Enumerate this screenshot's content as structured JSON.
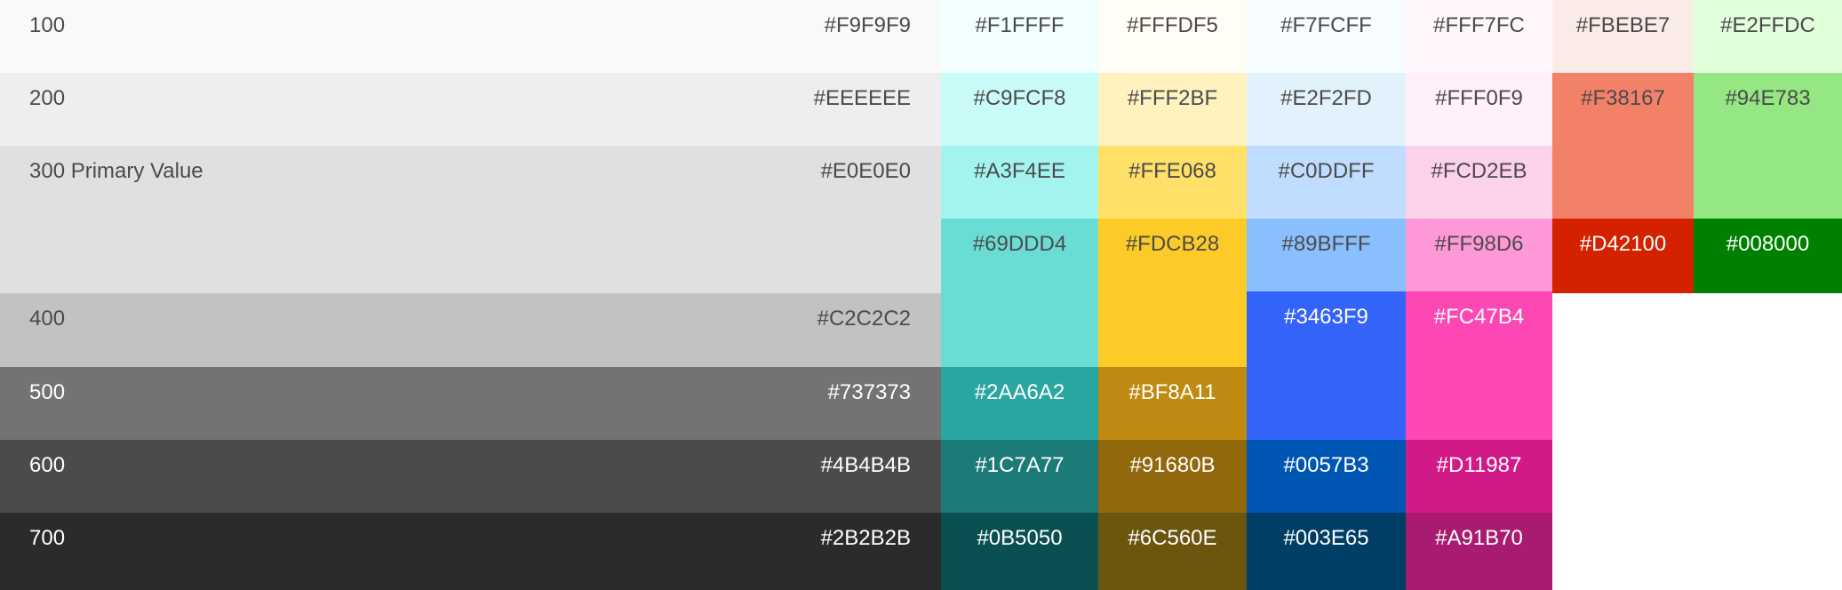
{
  "gray": [
    {
      "label": "100",
      "hex": "#F9F9F9",
      "color": "#F9F9F9",
      "text_color": "#4B4B4B"
    },
    {
      "label": "200",
      "hex": "#EEEEEE",
      "color": "#EEEEEE",
      "text_color": "#4B4B4B"
    },
    {
      "label": "300 Primary Value",
      "hex": "#E0E0E0",
      "color": "#E0E0E0",
      "text_color": "#4B4B4B"
    },
    {
      "label": "400",
      "hex": "#C2C2C2",
      "color": "#C2C2C2",
      "text_color": "#4B4B4B"
    },
    {
      "label": "500",
      "hex": "#737373",
      "color": "#737373",
      "text_color": "#FFFFFF"
    },
    {
      "label": "600",
      "hex": "#4B4B4B",
      "color": "#4B4B4B",
      "text_color": "#FFFFFF"
    },
    {
      "label": "700",
      "hex": "#2B2B2B",
      "color": "#2B2B2B",
      "text_color": "#FFFFFF"
    }
  ],
  "teal": [
    {
      "hex": "#F1FFFF",
      "color": "#F1FFFF",
      "text_color": "#4B4B4B"
    },
    {
      "hex": "#C9FCF8",
      "color": "#C9FCF8",
      "text_color": "#4B4B4B"
    },
    {
      "hex": "#A3F4EE",
      "color": "#A3F4EE",
      "text_color": "#4B4B4B"
    },
    {
      "hex": "#69DDD4",
      "color": "#69DDD4",
      "text_color": "#4B4B4B"
    },
    {
      "hex": "#2AA6A2",
      "color": "#2AA6A2",
      "text_color": "#FFFFFF"
    },
    {
      "hex": "#1C7A77",
      "color": "#1C7A77",
      "text_color": "#FFFFFF"
    },
    {
      "hex": "#0B5050",
      "color": "#0B5050",
      "text_color": "#FFFFFF"
    }
  ],
  "yellow": [
    {
      "hex": "#FFFDF5",
      "color": "#FFFDF5",
      "text_color": "#4B4B4B"
    },
    {
      "hex": "#FFF2BF",
      "color": "#FFF2BF",
      "text_color": "#4B4B4B"
    },
    {
      "hex": "#FFE068",
      "color": "#FFE068",
      "text_color": "#4B4B4B"
    },
    {
      "hex": "#FDCB28",
      "color": "#FDCB28",
      "text_color": "#4B4B4B"
    },
    {
      "hex": "#BF8A11",
      "color": "#BF8A11",
      "text_color": "#FFFFFF"
    },
    {
      "hex": "#91680B",
      "color": "#91680B",
      "text_color": "#FFFFFF"
    },
    {
      "hex": "#6C560E",
      "color": "#6C560E",
      "text_color": "#FFFFFF"
    }
  ],
  "blue": [
    {
      "hex": "#F7FCFF",
      "color": "#F7FCFF",
      "text_color": "#4B4B4B"
    },
    {
      "hex": "#E2F2FD",
      "color": "#E2F2FD",
      "text_color": "#4B4B4B"
    },
    {
      "hex": "#C0DDFF",
      "color": "#C0DDFF",
      "text_color": "#4B4B4B"
    },
    {
      "hex": "#89BFFF",
      "color": "#89BFFF",
      "text_color": "#4B4B4B"
    },
    {
      "hex": "#3463F9",
      "color": "#3463F9",
      "text_color": "#FFFFFF"
    },
    {
      "hex": "#0057B3",
      "color": "#0057B3",
      "text_color": "#FFFFFF"
    },
    {
      "hex": "#003E65",
      "color": "#003E65",
      "text_color": "#FFFFFF"
    }
  ],
  "pink": [
    {
      "hex": "#FFF7FC",
      "color": "#FFF7FC",
      "text_color": "#4B4B4B"
    },
    {
      "hex": "#FFF0F9",
      "color": "#FFF0F9",
      "text_color": "#4B4B4B"
    },
    {
      "hex": "#FCD2EB",
      "color": "#FCD2EB",
      "text_color": "#4B4B4B"
    },
    {
      "hex": "#FF98D6",
      "color": "#FF98D6",
      "text_color": "#4B4B4B"
    },
    {
      "hex": "#FC47B4",
      "color": "#FC47B4",
      "text_color": "#FFFFFF"
    },
    {
      "hex": "#D11987",
      "color": "#D11987",
      "text_color": "#FFFFFF"
    },
    {
      "hex": "#A91B70",
      "color": "#A91B70",
      "text_color": "#FFFFFF"
    }
  ],
  "red": [
    {
      "hex": "#FBEBE7",
      "color": "#FBEBE7",
      "text_color": "#4B4B4B"
    },
    {
      "hex": "#F38167",
      "color": "#F38167",
      "text_color": "#4B4B4B"
    },
    {
      "hex": "#D42100",
      "color": "#D42100",
      "text_color": "#FFFFFF"
    }
  ],
  "green": [
    {
      "hex": "#E2FFDC",
      "color": "#E2FFDC",
      "text_color": "#4B4B4B"
    },
    {
      "hex": "#94E783",
      "color": "#94E783",
      "text_color": "#4B4B4B"
    },
    {
      "hex": "#008000",
      "color": "#008000",
      "text_color": "#FFFFFF"
    }
  ]
}
